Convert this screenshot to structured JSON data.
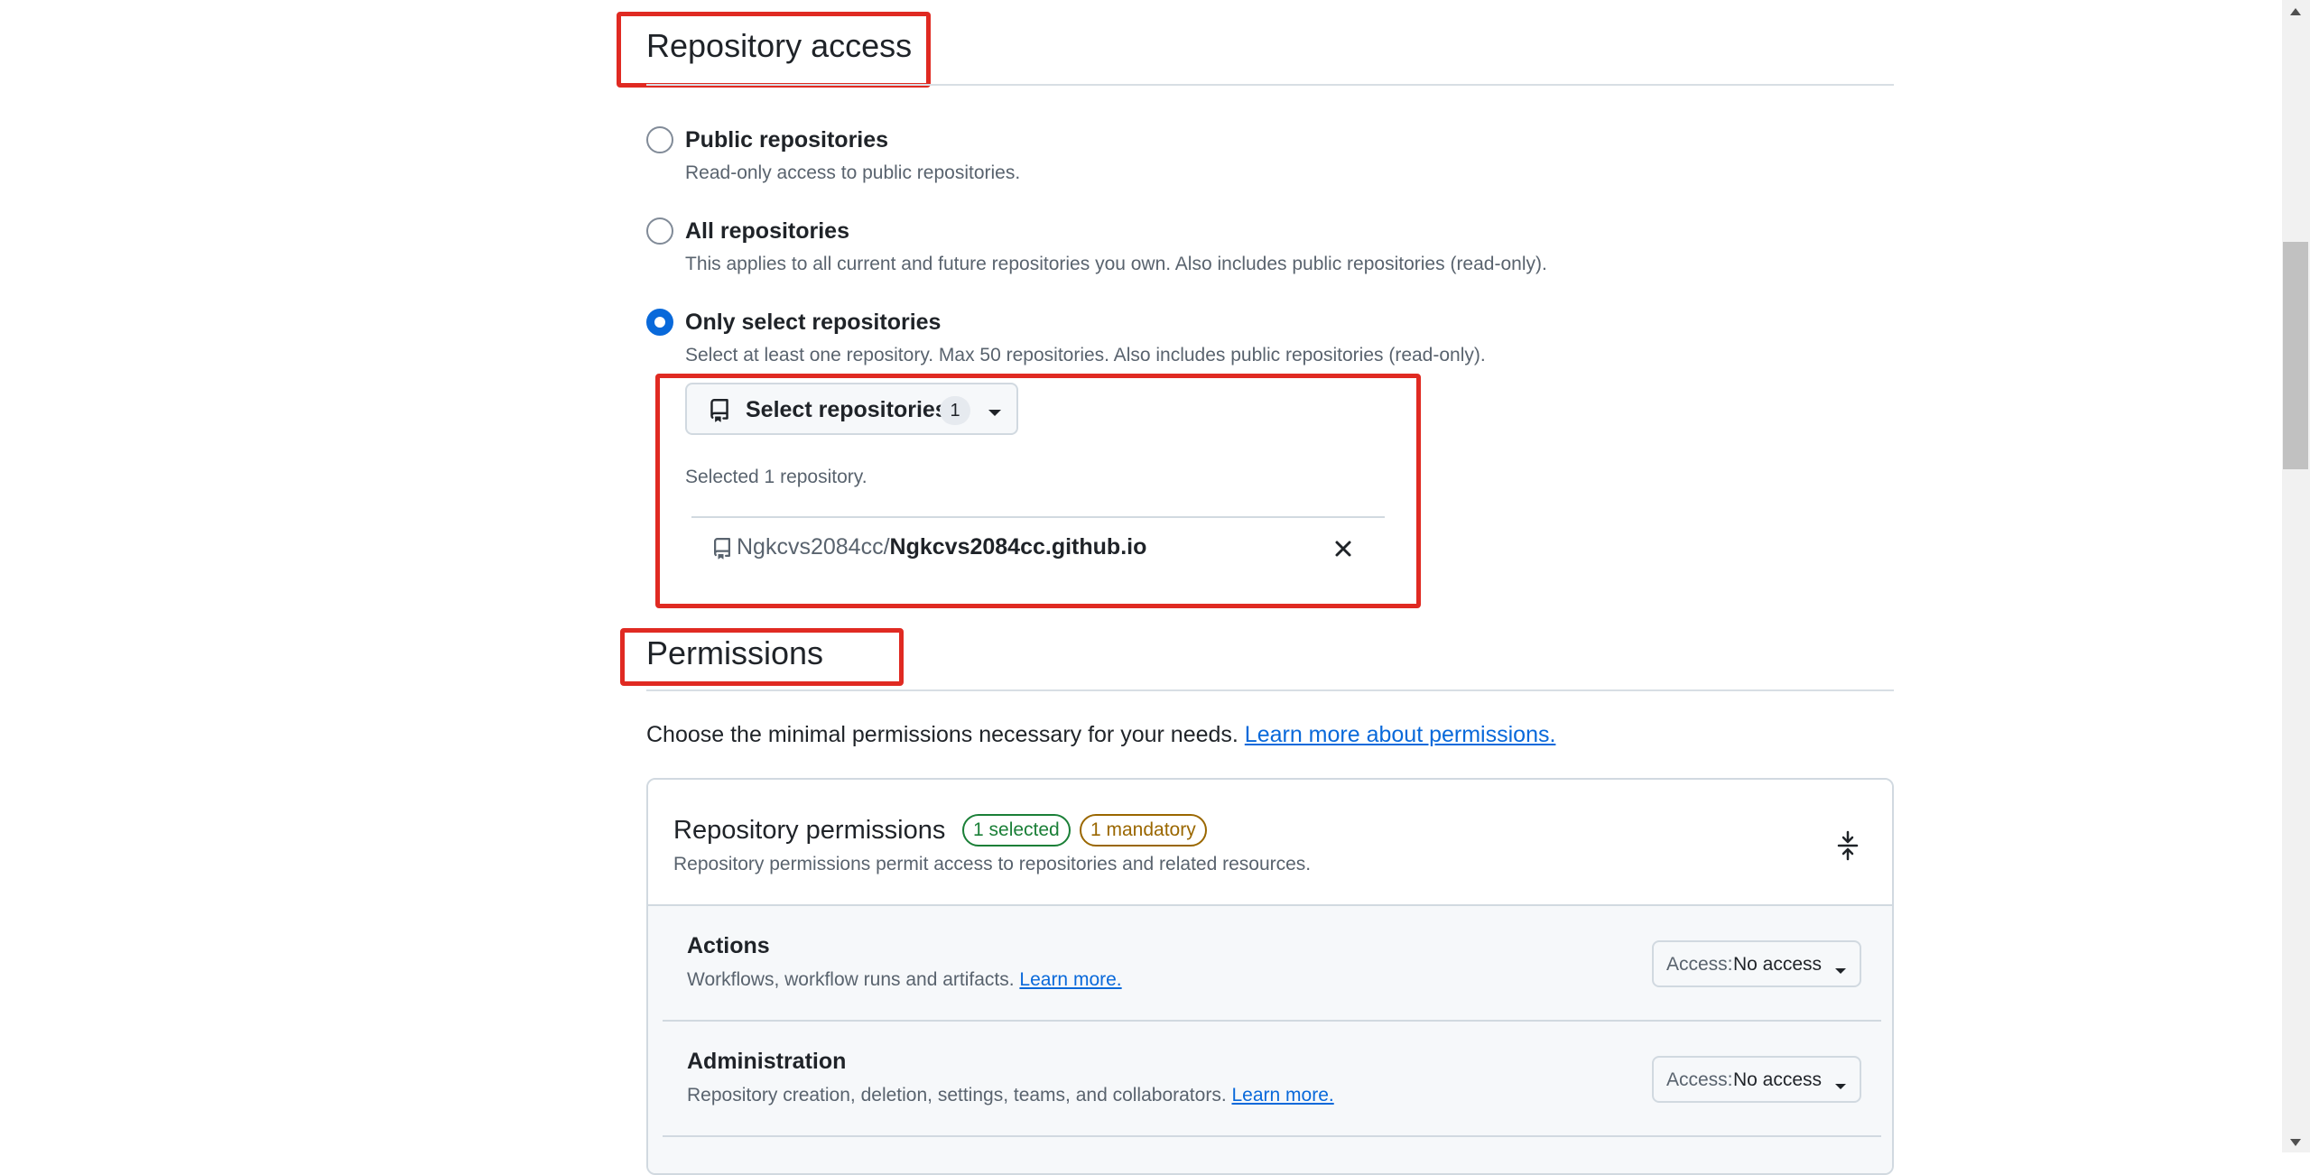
{
  "repository_access": {
    "heading": "Repository access",
    "options": [
      {
        "title": "Public repositories",
        "description": "Read-only access to public repositories.",
        "checked": false
      },
      {
        "title": "All repositories",
        "description": "This applies to all current and future repositories you own. Also includes public repositories (read-only).",
        "checked": false
      },
      {
        "title": "Only select repositories",
        "description": "Select at least one repository. Max 50 repositories. Also includes public repositories (read-only).",
        "checked": true
      }
    ],
    "select_button": {
      "label": "Select repositories",
      "count": "1"
    },
    "selected_text": "Selected 1 repository.",
    "selected_repo": {
      "owner": "Ngkcvs2084cc/",
      "name": "Ngkcvs2084cc.github.io"
    }
  },
  "permissions": {
    "heading": "Permissions",
    "intro": "Choose the minimal permissions necessary for your needs. ",
    "intro_link": "Learn more about permissions.",
    "card": {
      "title": "Repository permissions",
      "badge_selected": "1 selected",
      "badge_mandatory": "1 mandatory",
      "description": "Repository permissions permit access to repositories and related resources.",
      "rows": [
        {
          "title": "Actions",
          "description": "Workflows, workflow runs and artifacts. ",
          "link": "Learn more.",
          "access_label": "Access:",
          "access_value": "No access"
        },
        {
          "title": "Administration",
          "description": "Repository creation, deletion, settings, teams, and collaborators. ",
          "link": "Learn more.",
          "access_label": "Access:",
          "access_value": "No access"
        }
      ]
    }
  },
  "colors": {
    "accent": "#0969da",
    "highlight": "#e02a22",
    "success": "#1a7f37",
    "attention": "#9a6700"
  }
}
